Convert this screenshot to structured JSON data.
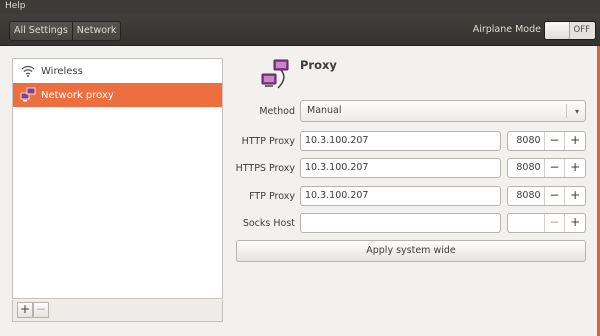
{
  "menubar": {
    "help": "Help"
  },
  "toolbar": {
    "breadcrumbs": [
      "All Settings",
      "Network"
    ],
    "airplane_label": "Airplane Mode",
    "airplane_state": "OFF"
  },
  "devices": [
    {
      "label": "Wireless",
      "icon": "wifi-icon"
    },
    {
      "label": "Network proxy",
      "icon": "network-proxy-icon"
    }
  ],
  "left_actions": {
    "add": "+",
    "remove": "−"
  },
  "proxy": {
    "title": "Proxy",
    "method_label": "Method",
    "method_value": "Manual",
    "http_label": "HTTP Proxy",
    "http_host": "10.3.100.207",
    "http_port": "8080",
    "https_label": "HTTPS Proxy",
    "https_host": "10.3.100.207",
    "https_port": "8080",
    "ftp_label": "FTP Proxy",
    "ftp_host": "10.3.100.207",
    "ftp_port": "8080",
    "socks_label": "Socks Host",
    "socks_host": "",
    "socks_port": "",
    "minus": "−",
    "plus": "+",
    "apply_label": "Apply system wide"
  },
  "colors": {
    "selection": "#ed6f3f",
    "toolbar": "#3c3b37"
  }
}
